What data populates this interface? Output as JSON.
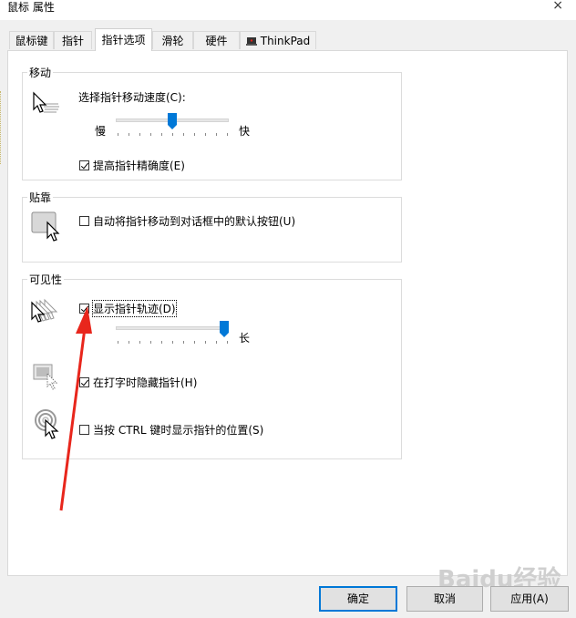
{
  "window": {
    "title": "鼠标 属性",
    "close_glyph": "×"
  },
  "tabs": [
    {
      "label": "鼠标键"
    },
    {
      "label": "指针"
    },
    {
      "label": "指针选项"
    },
    {
      "label": "滑轮"
    },
    {
      "label": "硬件"
    },
    {
      "label": "ThinkPad"
    }
  ],
  "motion": {
    "group_label": "移动",
    "speed_label": "选择指针移动速度(C):",
    "slow_label": "慢",
    "fast_label": "快",
    "speed_level": 0.5,
    "precision_label": "提高指针精确度(E)",
    "precision_checked": true
  },
  "snap": {
    "group_label": "贴靠",
    "snap_label": "自动将指针移动到对话框中的默认按钮(U)",
    "snap_checked": false
  },
  "visibility": {
    "group_label": "可见性",
    "trails_label": "显示指针轨迹(D)",
    "trails_checked": true,
    "long_label": "长",
    "trail_level": 1.0,
    "hide_label": "在打字时隐藏指针(H)",
    "hide_checked": true,
    "ctrl_label": "当按 CTRL 键时显示指针的位置(S)",
    "ctrl_checked": false
  },
  "buttons": {
    "ok": "确定",
    "cancel": "取消",
    "apply": "应用(A)"
  },
  "colors": {
    "accent": "#0078d7",
    "annotation_arrow": "#e8261c"
  },
  "watermark": "Baidu经验"
}
